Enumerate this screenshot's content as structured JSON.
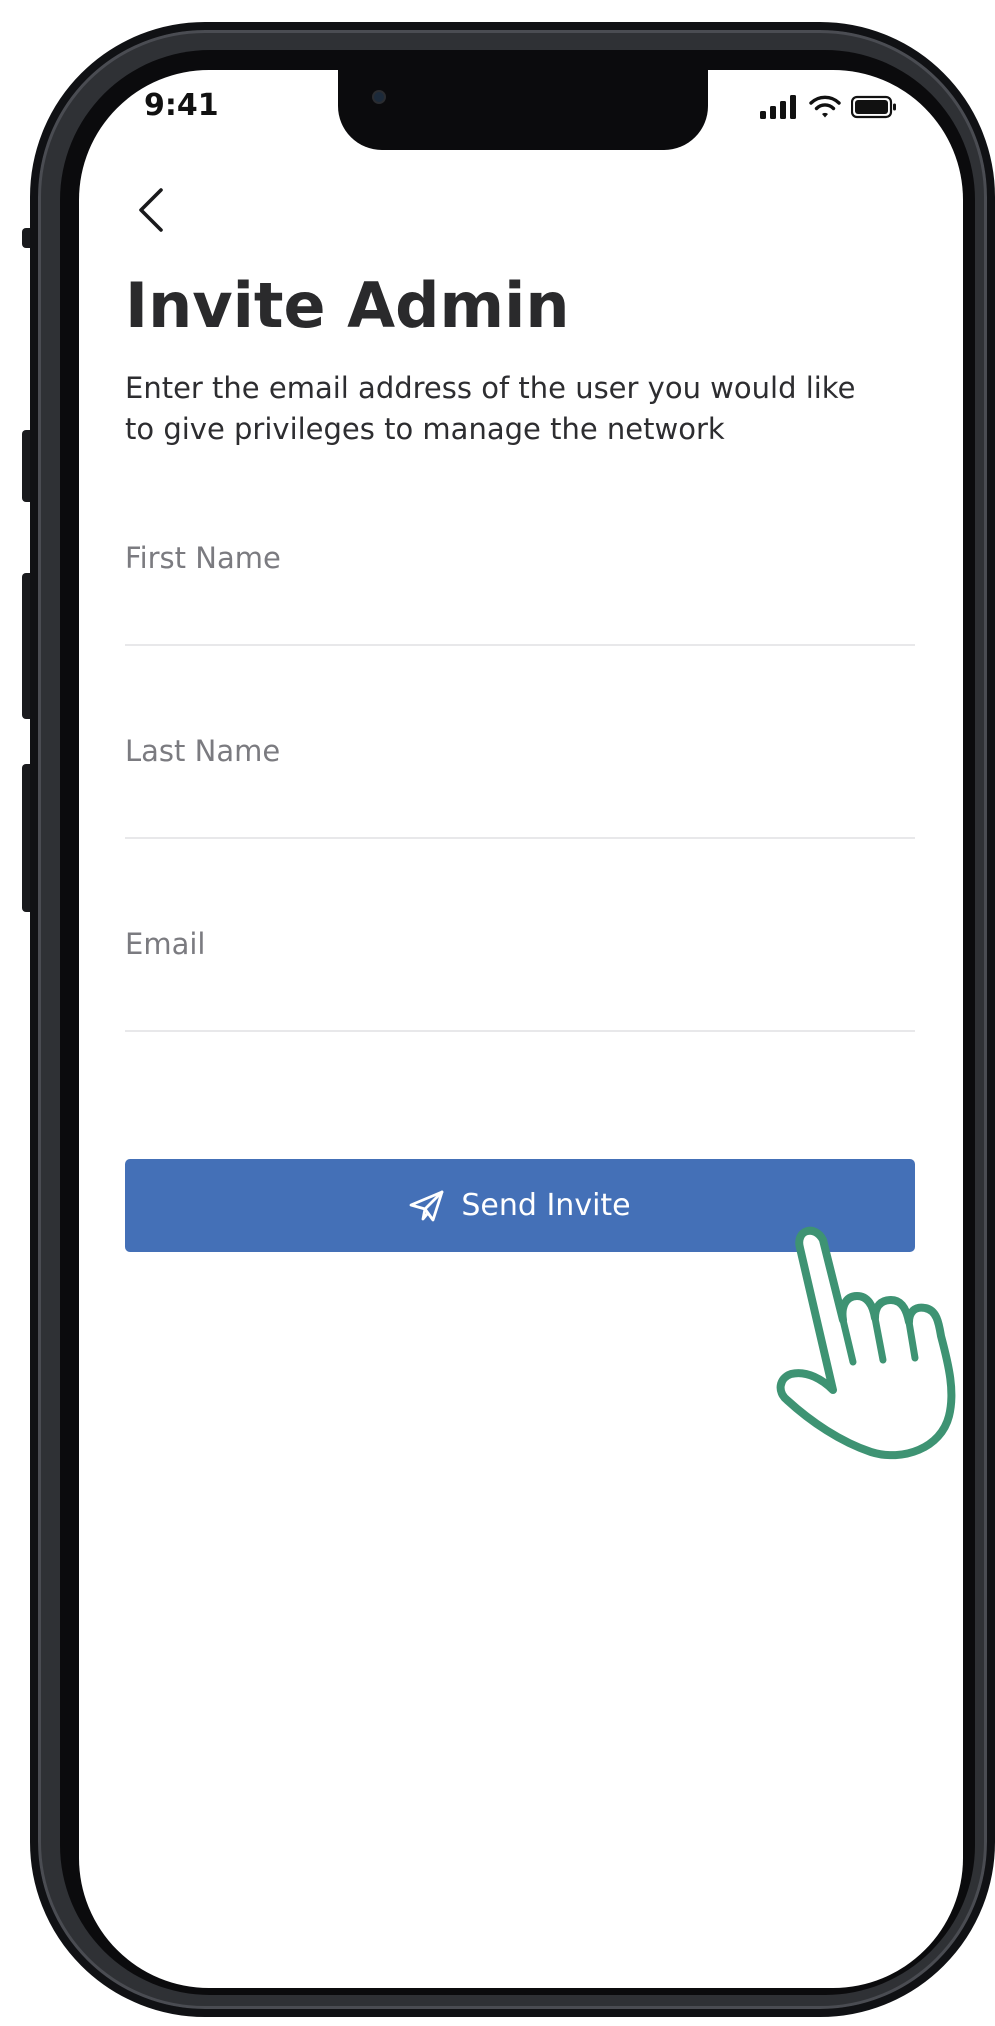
{
  "status_bar": {
    "time": "9:41",
    "icons": [
      "cellular-signal-icon",
      "wifi-icon",
      "battery-icon"
    ]
  },
  "header": {
    "back_icon": "chevron-left-icon",
    "title": "Invite Admin",
    "subtitle": "Enter the email address of the user you would like to give privileges to manage the network"
  },
  "form": {
    "first_name": {
      "label": "First Name",
      "value": ""
    },
    "last_name": {
      "label": "Last Name",
      "value": ""
    },
    "email": {
      "label": "Email",
      "value": ""
    }
  },
  "actions": {
    "send_label": "Send Invite",
    "send_icon": "paper-plane-icon"
  },
  "overlay": {
    "pointer_icon": "hand-pointer-icon"
  },
  "colors": {
    "button_fill": "#4470b7",
    "hand_outline": "#3e9373",
    "title_text": "#2a2a2c",
    "label_text": "#7b7b80",
    "divider": "#e8e8ea"
  }
}
